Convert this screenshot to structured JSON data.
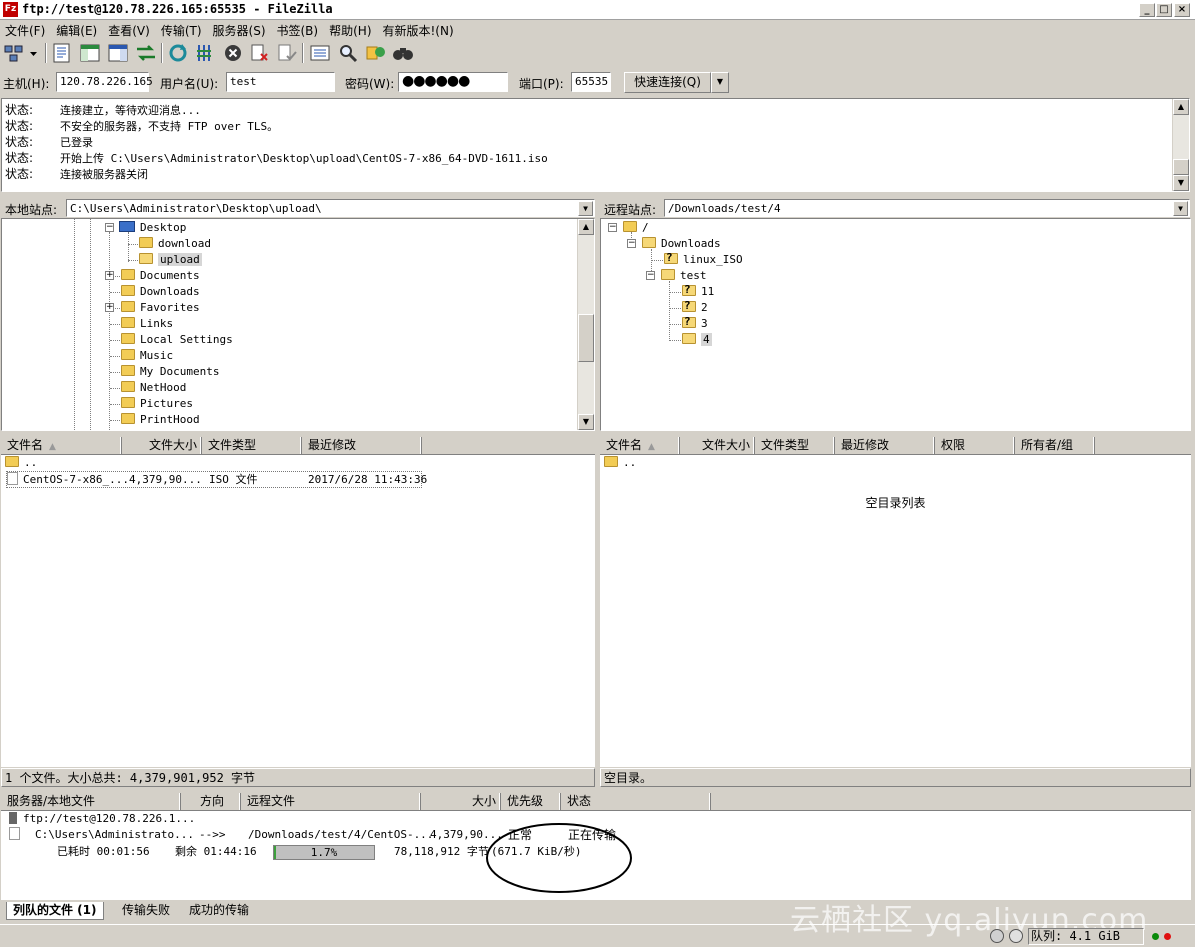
{
  "window": {
    "title": "ftp://test@120.78.226.165:65535 - FileZilla"
  },
  "menu": [
    "文件(F)",
    "编辑(E)",
    "查看(V)",
    "传输(T)",
    "服务器(S)",
    "书签(B)",
    "帮助(H)",
    "有新版本!(N)"
  ],
  "quickconnect": {
    "host_label": "主机(H):",
    "host": "120.78.226.165",
    "user_label": "用户名(U):",
    "user": "test",
    "pass_label": "密码(W):",
    "pass": "●●●●●●",
    "port_label": "端口(P):",
    "port": "65535",
    "connect": "快速连接(Q)"
  },
  "log": [
    {
      "k": "状态:",
      "v": "连接建立，等待欢迎消息..."
    },
    {
      "k": "状态:",
      "v": "不安全的服务器，不支持 FTP over TLS。"
    },
    {
      "k": "状态:",
      "v": "已登录"
    },
    {
      "k": "状态:",
      "v": "开始上传 C:\\Users\\Administrator\\Desktop\\upload\\CentOS-7-x86_64-DVD-1611.iso"
    },
    {
      "k": "状态:",
      "v": "连接被服务器关闭"
    }
  ],
  "local": {
    "label": "本地站点:",
    "path": "C:\\Users\\Administrator\\Desktop\\upload\\",
    "tree": [
      "Desktop",
      "download",
      "upload",
      "Documents",
      "Downloads",
      "Favorites",
      "Links",
      "Local Settings",
      "Music",
      "My Documents",
      "NetHood",
      "Pictures",
      "PrintHood"
    ],
    "columns": [
      "文件名",
      "文件大小",
      "文件类型",
      "最近修改"
    ],
    "parent": "..",
    "files": [
      {
        "name": "CentOS-7-x86_...",
        "size": "4,379,90...",
        "type": "ISO 文件",
        "modified": "2017/6/28 11:43:36"
      }
    ],
    "status": "1 个文件。大小总共: 4,379,901,952 字节"
  },
  "remote": {
    "label": "远程站点:",
    "path": "/Downloads/test/4",
    "tree": [
      "/",
      "Downloads",
      "linux_ISO",
      "test",
      "11",
      "2",
      "3",
      "4"
    ],
    "columns": [
      "文件名",
      "文件大小",
      "文件类型",
      "最近修改",
      "权限",
      "所有者/组"
    ],
    "parent": "..",
    "empty": "空目录列表",
    "status": "空目录。"
  },
  "queue": {
    "columns": [
      "服务器/本地文件",
      "方向",
      "远程文件",
      "大小",
      "优先级",
      "状态"
    ],
    "server": "ftp://test@120.78.226.1...",
    "local_file": "C:\\Users\\Administrato...",
    "direction": "-->>",
    "remote_file": "/Downloads/test/4/CentOS-...",
    "size": "4,379,90...",
    "priority": "正常",
    "state": "正在传输",
    "elapsed": "已耗时 00:01:56",
    "remaining": "剩余 01:44:16",
    "progress": 1.7,
    "progress_label": "1.7%",
    "bytes": "78,118,912 字节",
    "speed": "(671.7 KiB/秒)"
  },
  "tabs": [
    "列队的文件 (1)",
    "传输失败",
    "成功的传输"
  ],
  "statusbar": {
    "queue": "队列: 4.1 GiB"
  },
  "watermark": "云栖社区 yq.aliyun.com",
  "colors": {
    "accent": "#0a246a",
    "progress": "#3ca03c",
    "folder": "#f2cc55"
  }
}
